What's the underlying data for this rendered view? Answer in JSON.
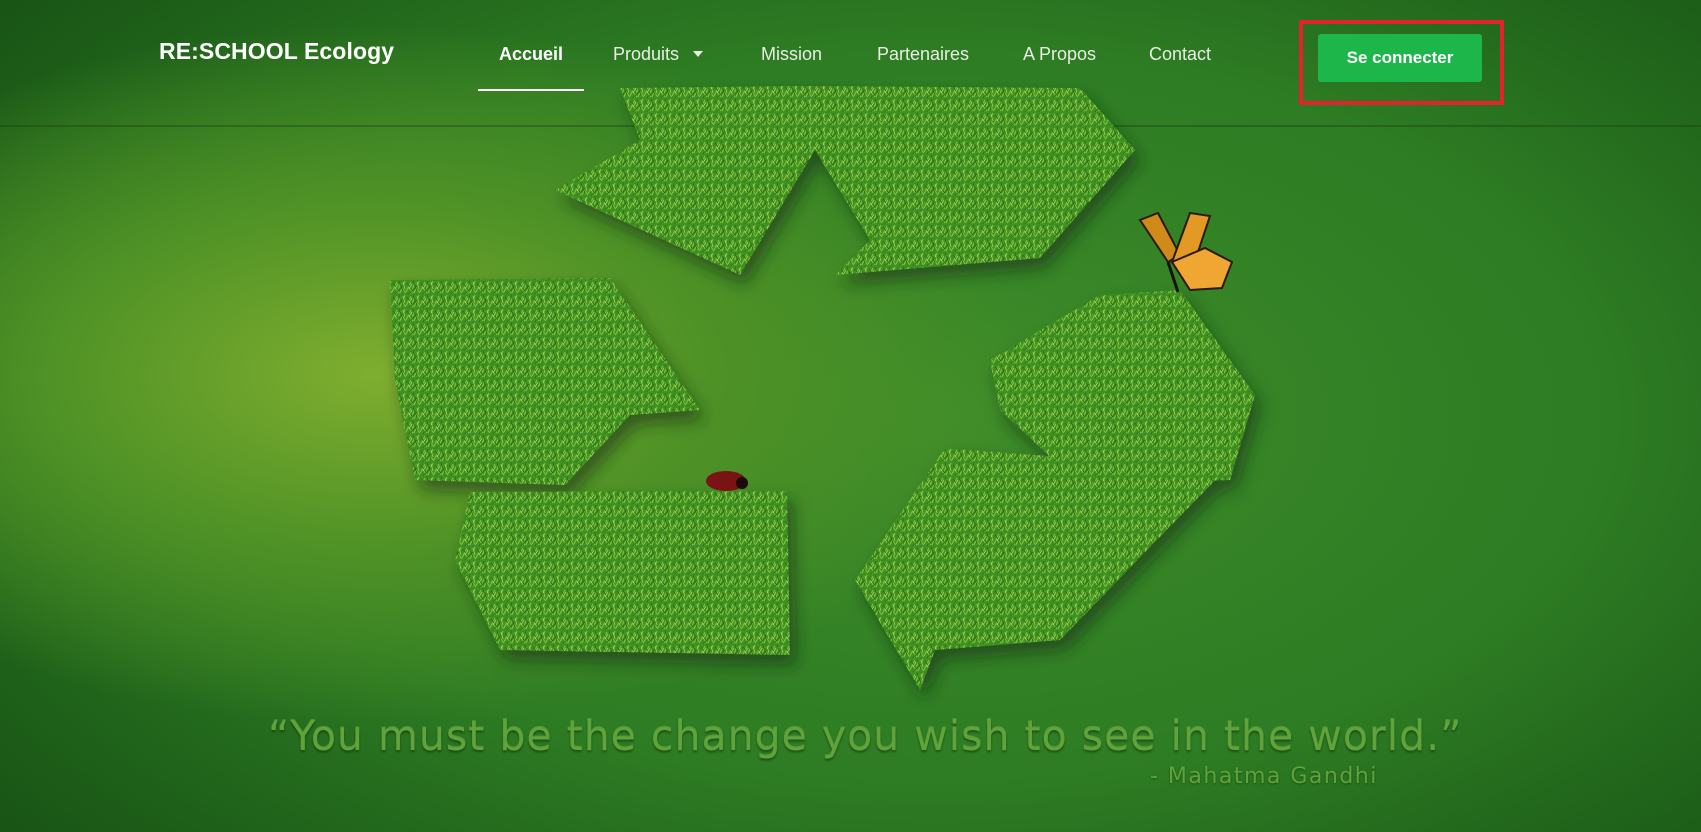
{
  "header": {
    "brand": "RE:SCHOOL Ecology",
    "nav": [
      {
        "label": "Accueil",
        "active": true
      },
      {
        "label": "Produits",
        "dropdown": true
      },
      {
        "label": "Mission"
      },
      {
        "label": "Partenaires"
      },
      {
        "label": "A Propos"
      },
      {
        "label": "Contact"
      }
    ],
    "login_label": "Se connecter"
  },
  "hero": {
    "quote": "“You must be the change you wish to see in the world.”",
    "author": "- Mahatma Gandhi"
  },
  "colors": {
    "accent": "#1db64a",
    "highlight": "#e2232b",
    "background": "#2d7b23"
  }
}
